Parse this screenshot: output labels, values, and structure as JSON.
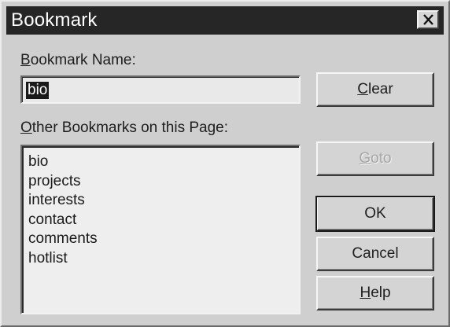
{
  "window": {
    "title": "Bookmark"
  },
  "bookmark_name": {
    "label_mnemonic": "B",
    "label_rest": "ookmark Name:",
    "value": "bio"
  },
  "other_bookmarks": {
    "label_mnemonic": "O",
    "label_rest": "ther Bookmarks on this Page:",
    "items": [
      "bio",
      "projects",
      "interests",
      "contact",
      "comments",
      "hotlist"
    ]
  },
  "buttons": {
    "clear": {
      "mnemonic": "C",
      "rest": "lear"
    },
    "goto": {
      "mnemonic": "G",
      "rest": "oto",
      "disabled": true
    },
    "ok": {
      "label": "OK"
    },
    "cancel": {
      "label": "Cancel"
    },
    "help": {
      "mnemonic": "H",
      "rest": "elp"
    }
  },
  "icons": {
    "close": "close-icon"
  }
}
